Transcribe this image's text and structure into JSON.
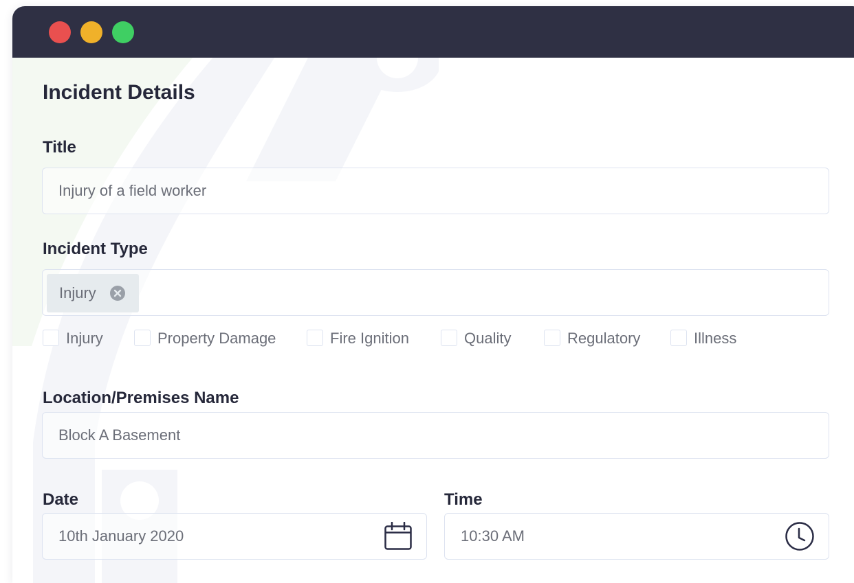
{
  "window": {
    "controls": [
      "close",
      "minimize",
      "maximize"
    ]
  },
  "form": {
    "heading": "Incident Details",
    "title": {
      "label": "Title",
      "value": "Injury of a field worker"
    },
    "incident_type": {
      "label": "Incident Type",
      "selected_chips": [
        {
          "label": "Injury",
          "remove_icon": "close-circle-icon"
        }
      ],
      "options": [
        {
          "label": "Injury",
          "checked": false
        },
        {
          "label": "Property Damage",
          "checked": false
        },
        {
          "label": "Fire Ignition",
          "checked": false
        },
        {
          "label": "Quality",
          "checked": false
        },
        {
          "label": "Regulatory",
          "checked": false
        },
        {
          "label": "Illness",
          "checked": false
        }
      ]
    },
    "location": {
      "label": "Location/Premises Name",
      "value": "Block A Basement"
    },
    "date": {
      "label": "Date",
      "value": "10th January 2020",
      "icon": "calendar-icon"
    },
    "time": {
      "label": "Time",
      "value": "10:30 AM",
      "icon": "clock-icon"
    }
  },
  "colors": {
    "titlebar": "#2f3044",
    "close": "#e9504f",
    "minimize": "#f0b12a",
    "maximize": "#3fcf63",
    "text_dark": "#26283a",
    "text_muted": "#6b6e78",
    "border": "#dde3f0",
    "icon": "#2a2c45"
  }
}
